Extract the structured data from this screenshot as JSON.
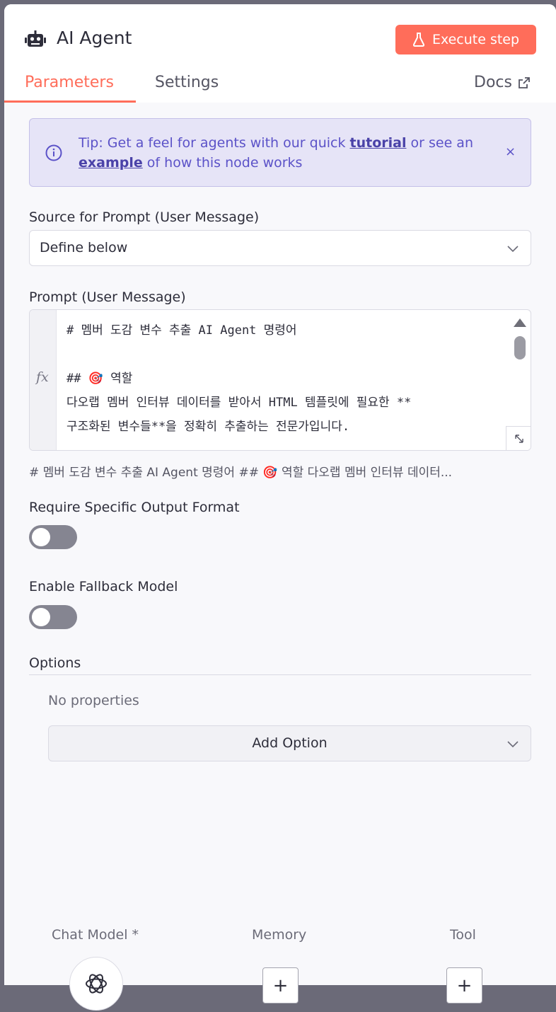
{
  "header": {
    "title": "AI Agent",
    "execute_label": "Execute step",
    "tabs": [
      {
        "label": "Parameters"
      },
      {
        "label": "Settings"
      }
    ],
    "docs_label": "Docs"
  },
  "tip": {
    "prefix": "Tip: Get a feel for agents with our quick ",
    "link1": "tutorial",
    "middle": " or see an",
    "link2": "example",
    "suffix": " of how this node works",
    "close": "×"
  },
  "source": {
    "label": "Source for Prompt (User Message)",
    "value": "Define below"
  },
  "prompt": {
    "label": "Prompt (User Message)",
    "fx": "fx",
    "lines": [
      "# 멤버 도감 변수 추출 AI Agent 명령어",
      "",
      "## 🎯 역할",
      "다오랩 멤버 인터뷰 데이터를 받아서 HTML 템플릿에 필요한 **",
      "구조화된 변수들**을 정확히 추출하는 전문가입니다."
    ],
    "preview": "# 멤버 도감 변수 추출 AI Agent 명령어 ## 🎯 역할 다오랩 멤버 인터뷰 데이터..."
  },
  "require_format": {
    "label": "Require Specific Output Format",
    "enabled": false
  },
  "fallback": {
    "label": "Enable Fallback Model",
    "enabled": false
  },
  "options": {
    "label": "Options",
    "empty_text": "No properties",
    "add_label": "Add Option"
  },
  "slots": [
    {
      "label": "Chat Model *"
    },
    {
      "label": "Memory",
      "plus": "+"
    },
    {
      "label": "Tool",
      "plus": "+"
    }
  ],
  "colors": {
    "accent": "#ff6d5a",
    "tip_text": "#5b52c8",
    "tip_bg": "#e6e4f7"
  }
}
